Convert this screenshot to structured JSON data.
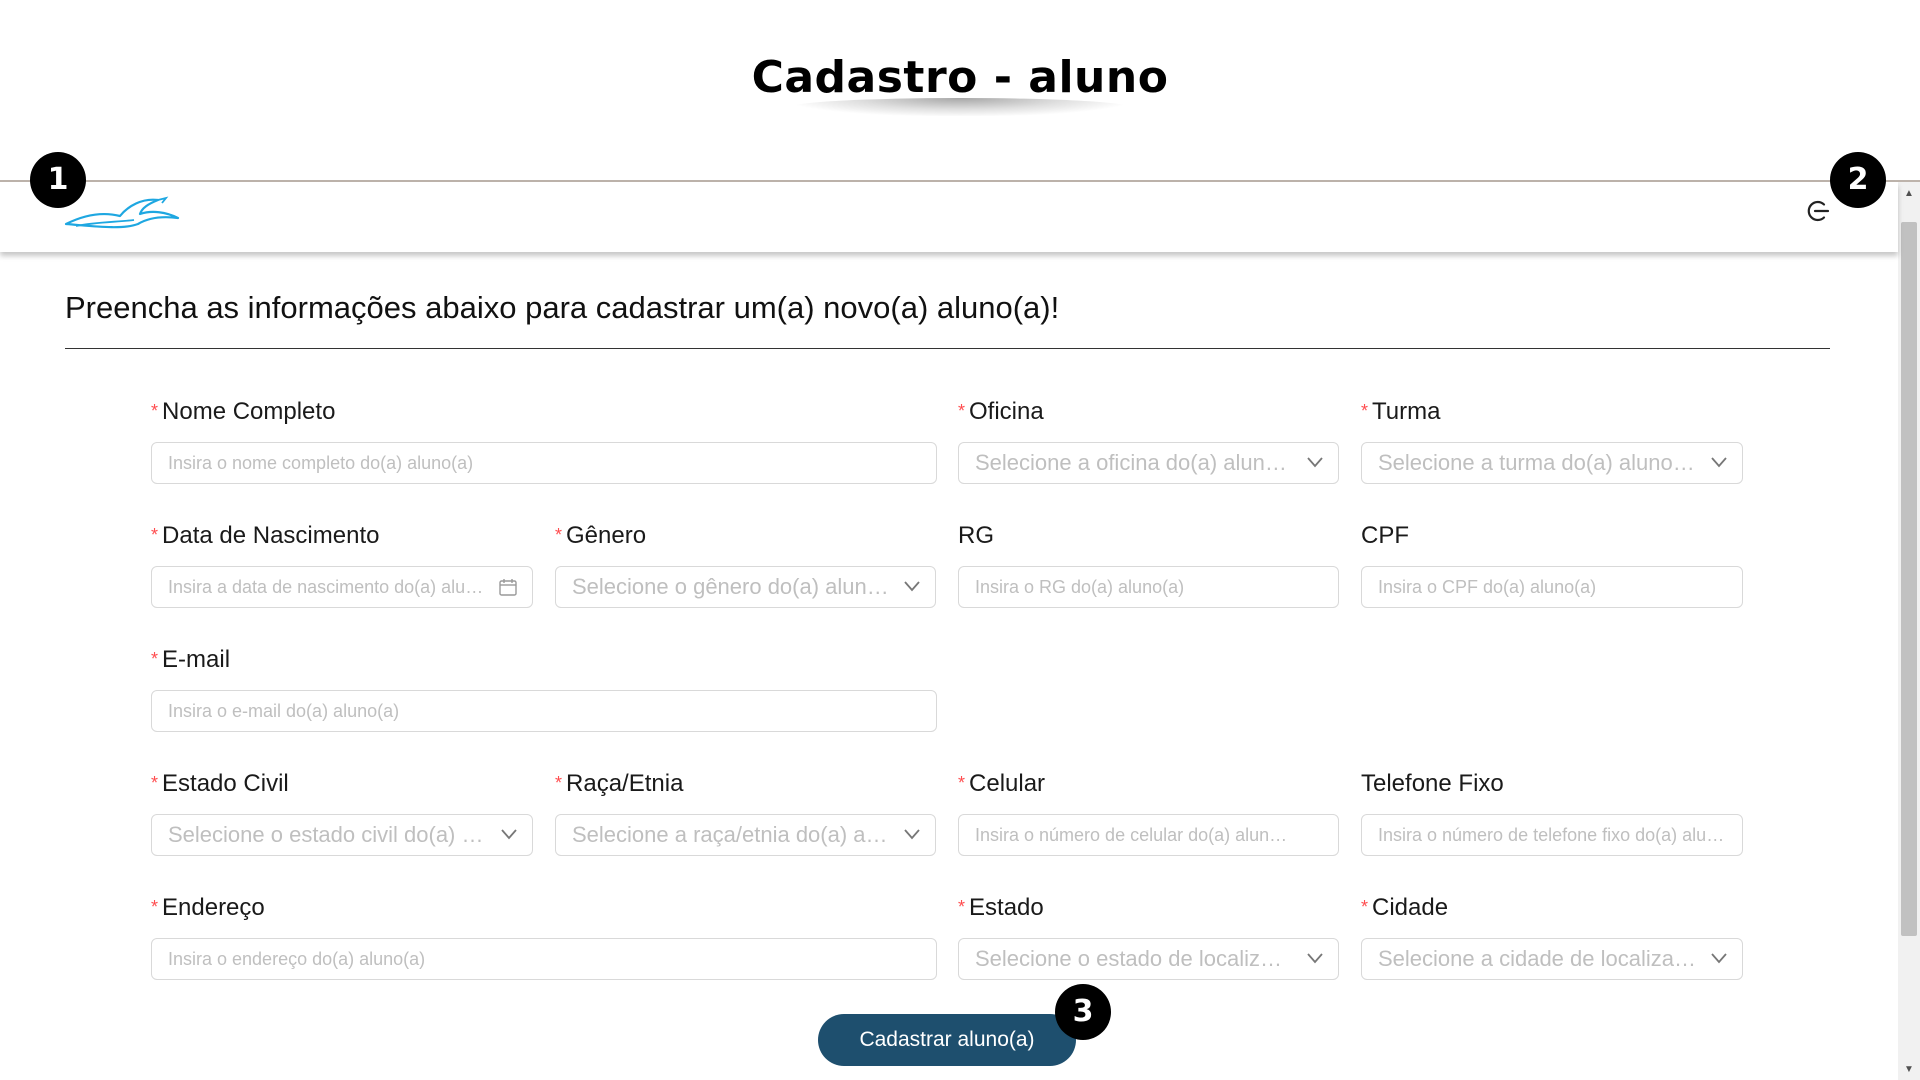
{
  "page_title": "Cadastro - aluno",
  "markers": [
    "1",
    "2",
    "3"
  ],
  "topbar": {
    "logo_icon": "bird-logo-icon",
    "logout_icon": "logout-icon"
  },
  "form": {
    "heading": "Preencha as informações abaixo para cadastrar um(a) novo(a) aluno(a)!",
    "fields": {
      "nome": {
        "label": "Nome Completo",
        "placeholder": "Insira o nome completo do(a) aluno(a)"
      },
      "oficina": {
        "label": "Oficina",
        "placeholder": "Selecione a oficina do(a) aluno(a)"
      },
      "turma": {
        "label": "Turma",
        "placeholder": "Selecione a turma do(a) aluno(a)"
      },
      "nascimento": {
        "label": "Data de Nascimento",
        "placeholder": "Insira a data de nascimento do(a) aluno(a)"
      },
      "genero": {
        "label": "Gênero",
        "placeholder": "Selecione o gênero do(a) aluno(a)"
      },
      "rg": {
        "label": "RG",
        "placeholder": "Insira o RG do(a) aluno(a)"
      },
      "cpf": {
        "label": "CPF",
        "placeholder": "Insira o CPF do(a) aluno(a)"
      },
      "email": {
        "label": "E-mail",
        "placeholder": "Insira o e-mail do(a) aluno(a)"
      },
      "estado_civil": {
        "label": "Estado Civil",
        "placeholder": "Selecione o estado civil do(a) aluno(a)"
      },
      "raca": {
        "label": "Raça/Etnia",
        "placeholder": "Selecione a raça/etnia do(a) aluno(a)"
      },
      "celular": {
        "label": "Celular",
        "placeholder": "Insira o número de celular do(a) aluno(a)"
      },
      "telefone": {
        "label": "Telefone Fixo",
        "placeholder": "Insira o número de telefone fixo do(a) aluno(a)"
      },
      "endereco": {
        "label": "Endereço",
        "placeholder": "Insira o endereço do(a) aluno(a)"
      },
      "estado": {
        "label": "Estado",
        "placeholder": "Selecione o estado de localização do(a) aluno(a)"
      },
      "cidade": {
        "label": "Cidade",
        "placeholder": "Selecione a cidade de localização do(a) aluno(a)"
      }
    },
    "submit_label": "Cadastrar aluno(a)"
  }
}
